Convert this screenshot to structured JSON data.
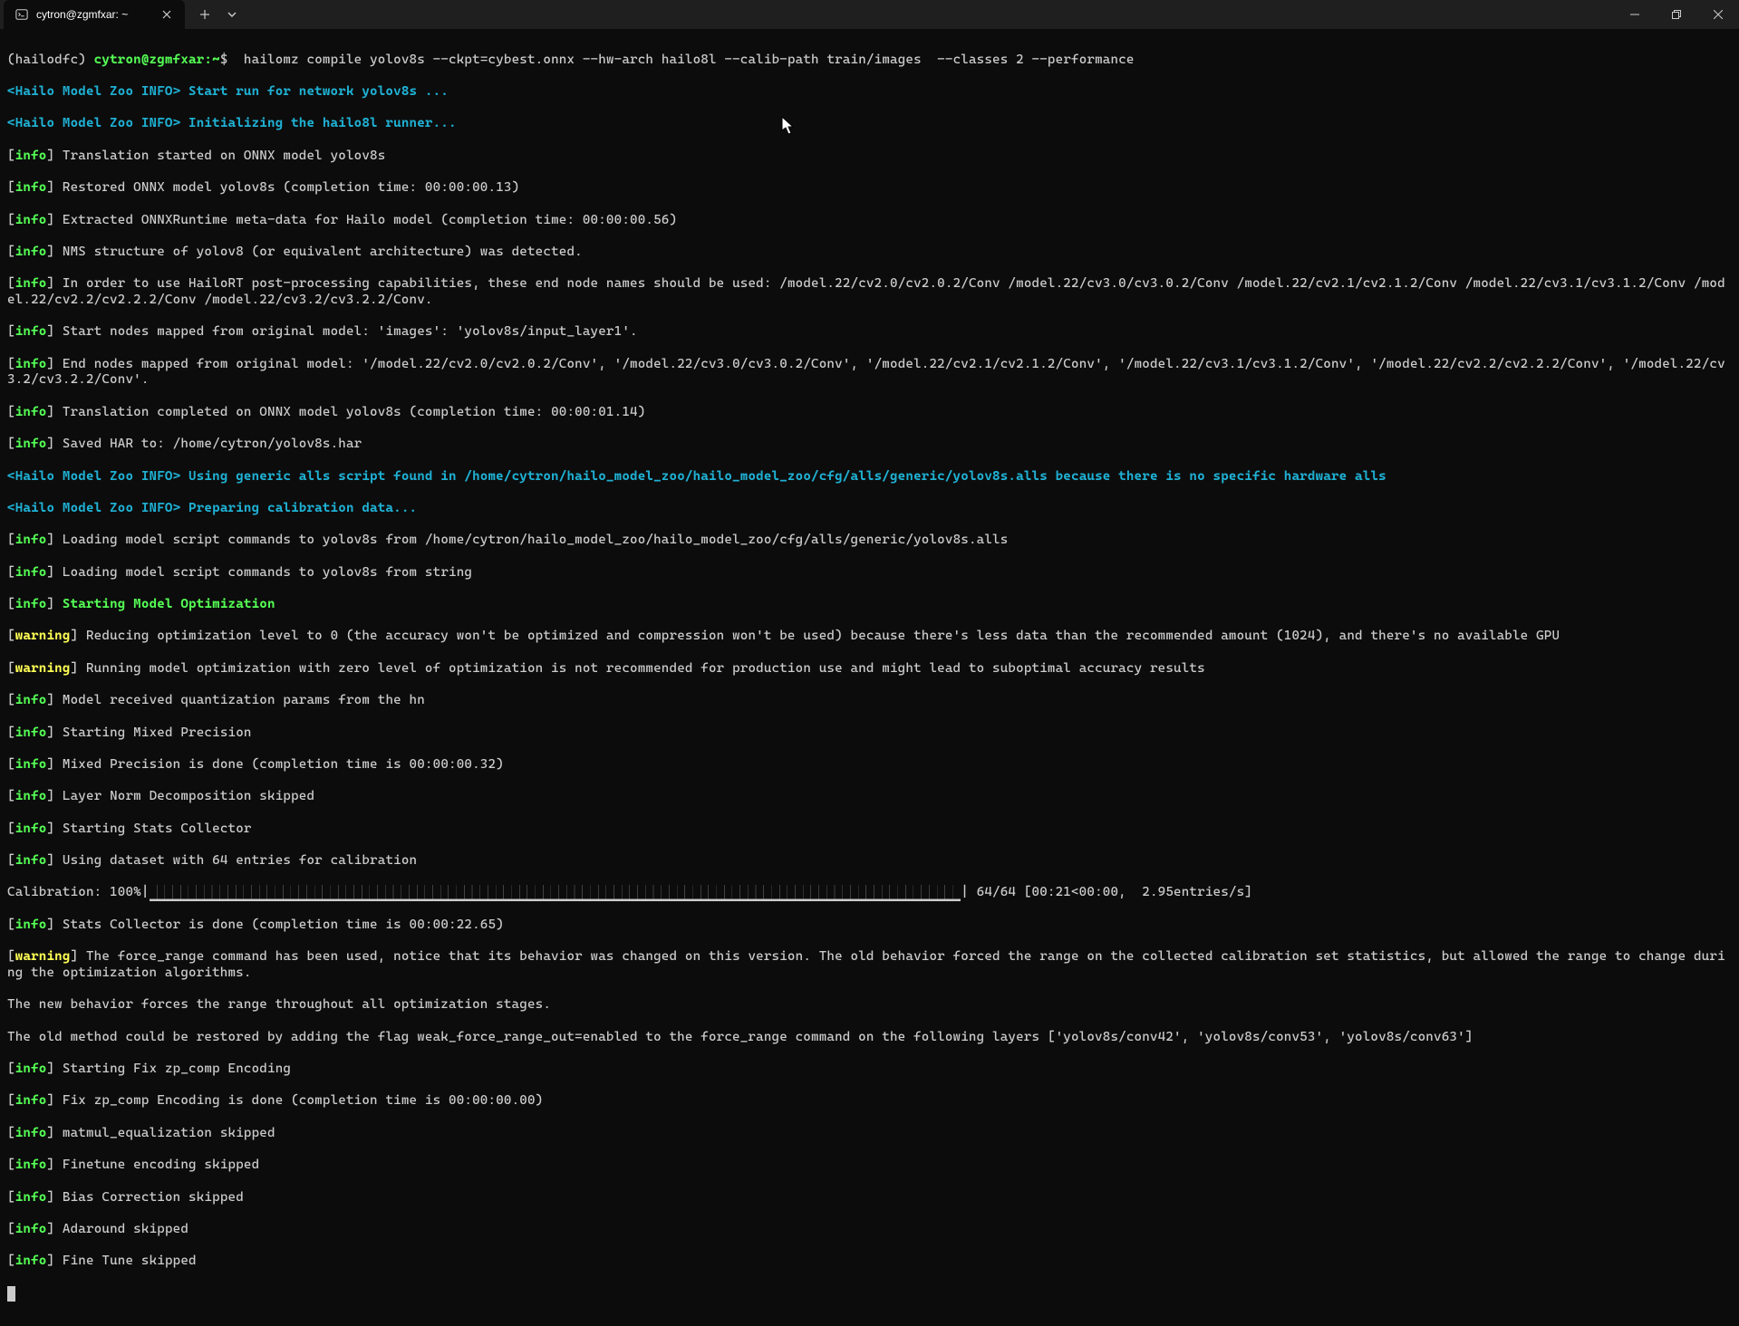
{
  "tab": {
    "title": "cytron@zgmfxar: ~"
  },
  "prompt": {
    "env": "(hailodfc)",
    "userhost": "cytron@zgmfxar",
    "path": "~",
    "symbol": "$",
    "command": " hailomz compile yolov8s --ckpt=cybest.onnx --hw-arch hailo8l --calib-path train/images  --classes 2 --performance"
  },
  "lines": {
    "l1": "Start run for network yolov8s ...",
    "l2": "Initializing the hailo8l runner...",
    "l3": "Translation started on ONNX model yolov8s",
    "l4": "Restored ONNX model yolov8s (completion time: 00:00:00.13)",
    "l5": "Extracted ONNXRuntime meta-data for Hailo model (completion time: 00:00:00.56)",
    "l6": "NMS structure of yolov8 (or equivalent architecture) was detected.",
    "l7": "In order to use HailoRT post-processing capabilities, these end node names should be used: /model.22/cv2.0/cv2.0.2/Conv /model.22/cv3.0/cv3.0.2/Conv /model.22/cv2.1/cv2.1.2/Conv /model.22/cv3.1/cv3.1.2/Conv /model.22/cv2.2/cv2.2.2/Conv /model.22/cv3.2/cv3.2.2/Conv.",
    "l8": "Start nodes mapped from original model: 'images': 'yolov8s/input_layer1'.",
    "l9": "End nodes mapped from original model: '/model.22/cv2.0/cv2.0.2/Conv', '/model.22/cv3.0/cv3.0.2/Conv', '/model.22/cv2.1/cv2.1.2/Conv', '/model.22/cv3.1/cv3.1.2/Conv', '/model.22/cv2.2/cv2.2.2/Conv', '/model.22/cv3.2/cv3.2.2/Conv'.",
    "l10": "Translation completed on ONNX model yolov8s (completion time: 00:00:01.14)",
    "l11": "Saved HAR to: /home/cytron/yolov8s.har",
    "l12": "Using generic alls script found in /home/cytron/hailo_model_zoo/hailo_model_zoo/cfg/alls/generic/yolov8s.alls because there is no specific hardware alls",
    "l13": "Preparing calibration data...",
    "l14": "Loading model script commands to yolov8s from /home/cytron/hailo_model_zoo/hailo_model_zoo/cfg/alls/generic/yolov8s.alls",
    "l15": "Loading model script commands to yolov8s from string",
    "l16": "Starting Model Optimization",
    "l17": "Reducing optimization level to 0 (the accuracy won't be optimized and compression won't be used) because there's less data than the recommended amount (1024), and there's no available GPU",
    "l18": "Running model optimization with zero level of optimization is not recommended for production use and might lead to suboptimal accuracy results",
    "l19": "Model received quantization params from the hn",
    "l20": "Starting Mixed Precision",
    "l21": "Mixed Precision is done (completion time is 00:00:00.32)",
    "l22": "Layer Norm Decomposition skipped",
    "l23": "Starting Stats Collector",
    "l24": "Using dataset with 64 entries for calibration",
    "calib_label": "Calibration: 100%|",
    "calib_fill": "███████████████████████████████████████████████████████████████████████████████████████████████████████",
    "calib_stats": "| 64/64 [00:21<00:00,  2.95entries/s]",
    "l25": "Stats Collector is done (completion time is 00:00:22.65)",
    "l26": "The force_range command has been used, notice that its behavior was changed on this version. The old behavior forced the range on the collected calibration set statistics, but allowed the range to change during the optimization algorithms.",
    "l27": "The new behavior forces the range throughout all optimization stages.",
    "l28": "The old method could be restored by adding the flag weak_force_range_out=enabled to the force_range command on the following layers ['yolov8s/conv42', 'yolov8s/conv53', 'yolov8s/conv63']",
    "l29": "Starting Fix zp_comp Encoding",
    "l30": "Fix zp_comp Encoding is done (completion time is 00:00:00.00)",
    "l31": "matmul_equalization skipped",
    "l32": "Finetune encoding skipped",
    "l33": "Bias Correction skipped",
    "l34": "Adaround skipped",
    "l35": "Fine Tune skipped"
  },
  "tags": {
    "hmz": "<Hailo Model Zoo INFO>",
    "info_open": "[",
    "info_word": "info",
    "info_close": "]",
    "warn_word": "warning"
  }
}
